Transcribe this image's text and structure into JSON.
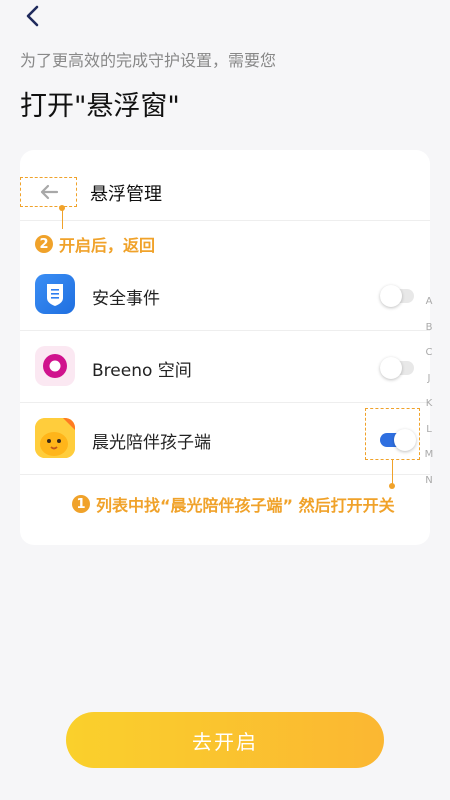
{
  "nav": {
    "back_icon": "chevron-left-icon"
  },
  "intro": {
    "subtitle": "为了更高效的完成守护设置，需要您",
    "title": "打开\"悬浮窗\""
  },
  "card": {
    "header_title": "悬浮管理",
    "back_icon": "arrow-left-icon",
    "step2": {
      "num": "2",
      "text": "开启后，返回"
    },
    "apps": [
      {
        "name": "安全事件",
        "icon": "security-events-icon",
        "enabled": false
      },
      {
        "name": "Breeno 空间",
        "icon": "breeno-space-icon",
        "enabled": false
      },
      {
        "name": "晨光陪伴孩子端",
        "icon": "chenguang-child-app-icon",
        "enabled": true
      }
    ],
    "step1": {
      "num": "1",
      "text": "列表中找“晨光陪伴孩子端” 然后打开开关"
    }
  },
  "index_letters": [
    "A",
    "B",
    "C",
    "J",
    "K",
    "L",
    "M",
    "N"
  ],
  "colors": {
    "accent": "#f0a22a",
    "toggle_on": "#2f6fe0",
    "button_start": "#fad02c",
    "button_end": "#fbb732"
  },
  "action": {
    "start_label": "去开启"
  }
}
